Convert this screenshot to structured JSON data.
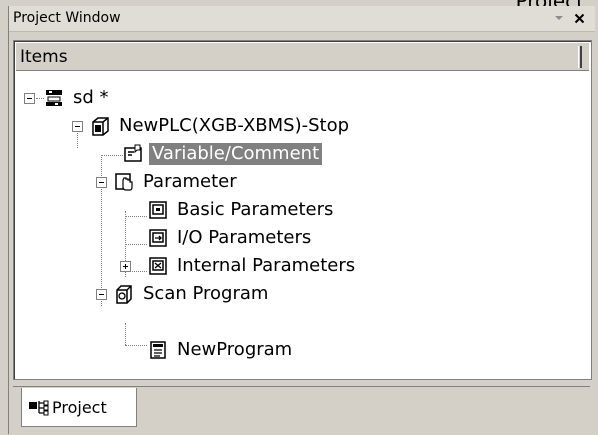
{
  "window": {
    "title": "Project Window",
    "partial_top_text": "Project"
  },
  "tree_panel": {
    "header_label": "Items",
    "nodes": [
      {
        "label": "sd *",
        "icon": "project-root-icon",
        "expanded": true
      },
      {
        "label": "NewPLC(XGB-XBMS)-Stop",
        "icon": "plc-icon",
        "expanded": true
      },
      {
        "label": "Variable/Comment",
        "icon": "variable-comment-icon",
        "selected": true
      },
      {
        "label": "Parameter",
        "icon": "parameter-icon",
        "expanded": true
      },
      {
        "label": "Basic Parameters",
        "icon": "basic-parameters-icon"
      },
      {
        "label": "I/O Parameters",
        "icon": "io-parameters-icon"
      },
      {
        "label": "Internal Parameters",
        "icon": "internal-parameters-icon",
        "expanded": false
      },
      {
        "label": "Scan Program",
        "icon": "scan-program-icon",
        "expanded": true
      },
      {
        "label": "NewProgram",
        "icon": "program-icon"
      }
    ]
  },
  "tabs": [
    {
      "label": "Project",
      "icon": "project-tab-icon",
      "active": true
    }
  ],
  "colors": {
    "selection_bg": "#808080",
    "panel_bg": "#ffffff",
    "chrome_bg": "#d4d0c8"
  }
}
